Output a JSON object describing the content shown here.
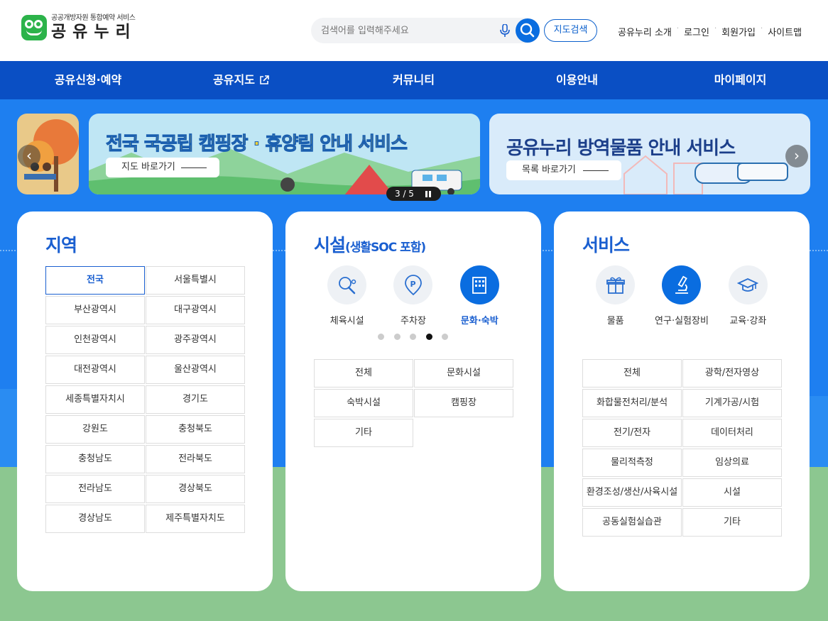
{
  "logo": {
    "sub": "공공개방자원 통합예약 서비스",
    "main": "공유누리"
  },
  "search": {
    "placeholder": "검색어를 입력해주세요",
    "map_button": "지도검색"
  },
  "util_links": [
    "공유누리 소개",
    "로그인",
    "회원가입",
    "사이트맵"
  ],
  "gnb": [
    "공유신청·예약",
    "공유지도",
    "커뮤니티",
    "이용안내",
    "마이페이지"
  ],
  "banners": [
    {
      "title": "전국 국공립 캠핑장 · 휴양림 안내 서비스",
      "button": "지도 바로가기"
    },
    {
      "title": "공유누리 방역물품 안내 서비스",
      "button": "목록 바로가기"
    }
  ],
  "pager": {
    "text": "3 / 5"
  },
  "region": {
    "title": "지역",
    "items": [
      "전국",
      "서울특별시",
      "부산광역시",
      "대구광역시",
      "인천광역시",
      "광주광역시",
      "대전광역시",
      "울산광역시",
      "세종특별자치시",
      "경기도",
      "강원도",
      "충청북도",
      "충청남도",
      "전라북도",
      "전라남도",
      "경상북도",
      "경상남도",
      "제주특별자치도"
    ],
    "selected": "전국"
  },
  "facility": {
    "title": "시설",
    "subtitle": "(생활SOC 포함)",
    "icons": [
      "체육시설",
      "주차장",
      "문화·숙박"
    ],
    "selected_icon": "문화·숙박",
    "indicator_count": 5,
    "indicator_active": 4,
    "items": [
      "전체",
      "문화시설",
      "숙박시설",
      "캠핑장",
      "기타"
    ]
  },
  "service": {
    "title": "서비스",
    "icons": [
      "물품",
      "연구·실험장비",
      "교육·강좌"
    ],
    "selected_icon": "연구·실험장비",
    "items": [
      "전체",
      "광학/전자영상",
      "화합물전처리/분석",
      "기계가공/시험",
      "전기/전자",
      "데이터처리",
      "물리적측정",
      "임상의료",
      "환경조성/생산/사육시설",
      "시설",
      "공동실험실습관",
      "기타"
    ]
  },
  "colors": {
    "primary": "#1a5fd0",
    "nav": "#0a4fc4",
    "sky": "#1e7ff0",
    "ground": "#8cc790"
  }
}
